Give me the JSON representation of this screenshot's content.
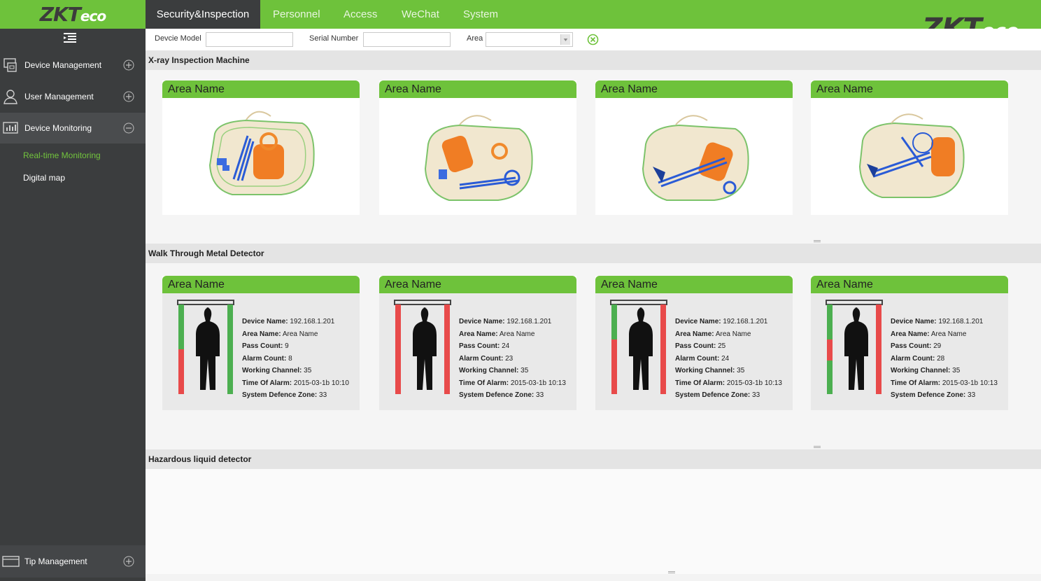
{
  "brand": {
    "logo_main": "ZKT",
    "logo_eco": "eco"
  },
  "tabs": [
    {
      "label": "Security&Inspection",
      "active": true
    },
    {
      "label": "Personnel"
    },
    {
      "label": "Access"
    },
    {
      "label": "WeChat"
    },
    {
      "label": "System"
    }
  ],
  "sidebar": {
    "items": [
      {
        "label": "Device Management",
        "icon": "device-icon",
        "toggle": "plus"
      },
      {
        "label": "User Management",
        "icon": "user-icon",
        "toggle": "plus"
      },
      {
        "label": "Device Monitoring",
        "icon": "monitor-icon",
        "toggle": "minus"
      }
    ],
    "submenu": [
      {
        "label": "Real-time Monitoring",
        "active": true
      },
      {
        "label": "Digital map"
      }
    ],
    "bottom_item": {
      "label": "Tip Management",
      "icon": "tip-icon",
      "toggle": "plus"
    }
  },
  "filters": {
    "device_model_label": "Devcie Model",
    "device_model_value": "",
    "serial_number_label": "Serial Number",
    "serial_number_value": "",
    "area_label": "Area",
    "area_value": ""
  },
  "sections": {
    "xray": {
      "title": "X-ray Inspection Machine",
      "cards": [
        {
          "area": "Area Name"
        },
        {
          "area": "Area Name"
        },
        {
          "area": "Area Name"
        },
        {
          "area": "Area Name"
        }
      ]
    },
    "walkthrough": {
      "title": "Walk Through Metal Detector",
      "field_labels": {
        "device_name": "Device Name:",
        "area_name": "Area Name:",
        "pass_count": "Pass Count:",
        "alarm_count": "Alarm Count:",
        "working_channel": "Working Channel:",
        "time_of_alarm": "Time Of Alarm:",
        "system_defence_zone": "System Defence Zone:"
      },
      "cards": [
        {
          "area": "Area Name",
          "device_name": "192.168.1.201",
          "area_name": "Area Name",
          "pass_count": "9",
          "alarm_count": "8",
          "working_channel": "35",
          "time_of_alarm": "2015-03-1b 10:10",
          "system_defence_zone": "33"
        },
        {
          "area": "Area Name",
          "device_name": "192.168.1.201",
          "area_name": "Area Name",
          "pass_count": "24",
          "alarm_count": "23",
          "working_channel": "35",
          "time_of_alarm": "2015-03-1b 10:13",
          "system_defence_zone": "33"
        },
        {
          "area": "Area Name",
          "device_name": "192.168.1.201",
          "area_name": "Area Name",
          "pass_count": "25",
          "alarm_count": "24",
          "working_channel": "35",
          "time_of_alarm": "2015-03-1b 10:13",
          "system_defence_zone": "33"
        },
        {
          "area": "Area Name",
          "device_name": "192.168.1.201",
          "area_name": "Area Name",
          "pass_count": "29",
          "alarm_count": "28",
          "working_channel": "35",
          "time_of_alarm": "2015-03-1b 10:13",
          "system_defence_zone": "33"
        }
      ]
    },
    "hazardous": {
      "title": "Hazardous liquid detector"
    }
  },
  "colors": {
    "accent": "#6ec23b",
    "sidebar": "#3b3d3e",
    "active_text": "#72c43d"
  }
}
